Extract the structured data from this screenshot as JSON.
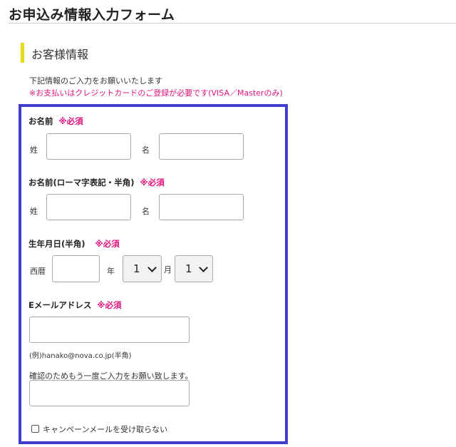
{
  "header": {
    "title": "お申込み情報入力フォーム"
  },
  "section": {
    "title": "お客様情報"
  },
  "intro": {
    "text": "下記情報のご入力をお願いいたします",
    "note": "※お支払いはクレジットカードのご登録が必要です(VISA／Masterのみ)"
  },
  "colors": {
    "accent_bar": "#e6dc1e",
    "form_border": "#3f3fcc",
    "required": "#e0157f"
  },
  "form": {
    "name": {
      "label": "お名前",
      "required": "※必須",
      "last_label": "姓",
      "first_label": "名",
      "last_value": "",
      "first_value": ""
    },
    "name_roman": {
      "label": "お名前(ローマ字表記・半角)",
      "required": "※必須",
      "last_label": "姓",
      "first_label": "名",
      "last_value": "",
      "first_value": ""
    },
    "birthdate": {
      "label": "生年月日(半角)",
      "required": "※必須",
      "era_label": "西暦",
      "year_value": "",
      "year_label": "年",
      "month_value": "1",
      "month_label": "月",
      "day_value": "1"
    },
    "email": {
      "label": "Eメールアドレス",
      "required": "※必須",
      "value": "",
      "example": "(例)hanako@nova.co.jp(半角)",
      "confirm_label": "確認のためもう一度ご入力をお願い致します。",
      "confirm_value": ""
    },
    "campaign": {
      "label": "キャンペーンメールを受け取らない",
      "checked": false
    }
  }
}
